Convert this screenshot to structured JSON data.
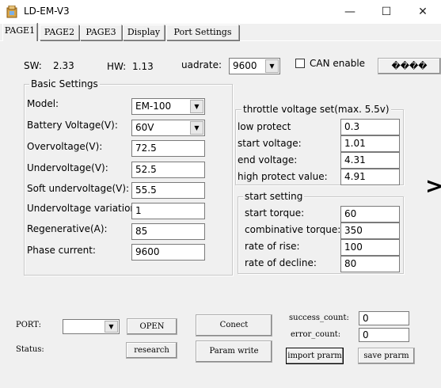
{
  "window": {
    "title": "LD-EM-V3",
    "minimize": "—",
    "maximize": "☐",
    "close": "✕"
  },
  "tabs": [
    {
      "label": "PAGE1"
    },
    {
      "label": "PAGE2"
    },
    {
      "label": "PAGE3"
    },
    {
      "label": "Display"
    },
    {
      "label": "Port Settings"
    }
  ],
  "info": {
    "sw_label": "SW:",
    "sw_value": "2.33",
    "hw_label": "HW:",
    "hw_value": "1.13",
    "quadrate_label": "uadrate:",
    "quadrate_value": "9600",
    "can_label": "CAN enable",
    "unknown_button": "����"
  },
  "basic": {
    "legend": "Basic Settings",
    "model_label": "Model:",
    "model_value": "EM-100",
    "battery_label": "Battery Voltage(V):",
    "battery_value": "60V",
    "overvoltage_label": "Overvoltage(V):",
    "overvoltage_value": "72.5",
    "undervoltage_label": "Undervoltage(V):",
    "undervoltage_value": "52.5",
    "soft_under_label": "Soft undervoltage(V):",
    "soft_under_value": "55.5",
    "under_variation_label": "Undervoltage variation:",
    "under_variation_value": "1",
    "regen_label": "Regenerative(A):",
    "regen_value": "85",
    "phase_label": "Phase current:",
    "phase_value": "9600"
  },
  "throttle": {
    "legend": "throttle voltage set(max. 5.5v)",
    "low_label": "low protect",
    "low_value": "0.3",
    "start_label": "start voltage:",
    "start_value": "1.01",
    "end_label": "end voltage:",
    "end_value": "4.31",
    "high_label": "high protect value:",
    "high_value": "4.91"
  },
  "start": {
    "legend": "start setting",
    "torque_label": "start torque:",
    "torque_value": "60",
    "comb_label": "combinative torque:",
    "comb_value": "350",
    "rise_label": "rate of rise:",
    "rise_value": "100",
    "decline_label": "rate of decline:",
    "decline_value": "80"
  },
  "next_arrow": ">",
  "bottom": {
    "port_label": "PORT:",
    "port_value": "",
    "open_button": "OPEN",
    "status_label": "Status:",
    "research_button": "research",
    "connect_button": "Conect",
    "param_write_button": "Param write",
    "success_label": "success_count:",
    "success_value": "0",
    "error_label": "error_count:",
    "error_value": "0",
    "import_button": "import prarm",
    "save_button": "save prarm"
  }
}
